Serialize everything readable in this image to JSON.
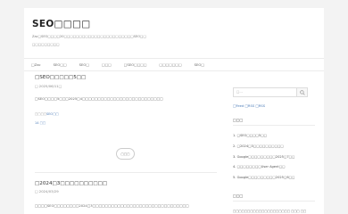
{
  "header": {
    "title": "SEO□□□□",
    "description_line1": "Zac□SEO□□□□20□□□□□□□□□□□□□□□□□□□□□□□SEO□□",
    "description_line2": "□□□□□□□□□"
  },
  "nav": {
    "items": [
      "□Zac",
      "SEO□□",
      "SEO□",
      "□□□",
      "□SEO□□□□",
      "□□□□□□□",
      "SEO□"
    ]
  },
  "posts": [
    {
      "title": "□SEO□□□□□5□□",
      "date": "□ 2025/06/11□",
      "excerpt": "□SEO□□□□5□□□2025□4□□□□□□□□□□□□□□□□□□□□□□□□□□",
      "tag_label": "□□□□",
      "tag": "SEO□□",
      "views": "14 □□"
    },
    {
      "title": "□2024□3□□□□□□□□□□",
      "date": "□ 2024/03/29",
      "excerpt": "□□□□SEO□□□□□□□□2024□3□□□□□□□□□□□□□□□□□□□□□□□□□□□□□□□"
    }
  ],
  "more_button": "□□□",
  "sidebar": {
    "search_placeholder": "□...",
    "feed_text": "□Feed □RSS □RSS",
    "heading1": "□□□",
    "recent": [
      "1. □SEO□□□□5□□",
      "2. □2024□3□□□□□□□□□□",
      "3. Google□□□□□□□□□2025□7□□",
      "4. □□□□□□□□User Agent□□",
      "5. Google□□□□□□□□□2025□6□□"
    ],
    "heading2": "□□□",
    "comment_preview": "□□□□□□□□□□□□□□□□□□□□ □□□ □□"
  }
}
